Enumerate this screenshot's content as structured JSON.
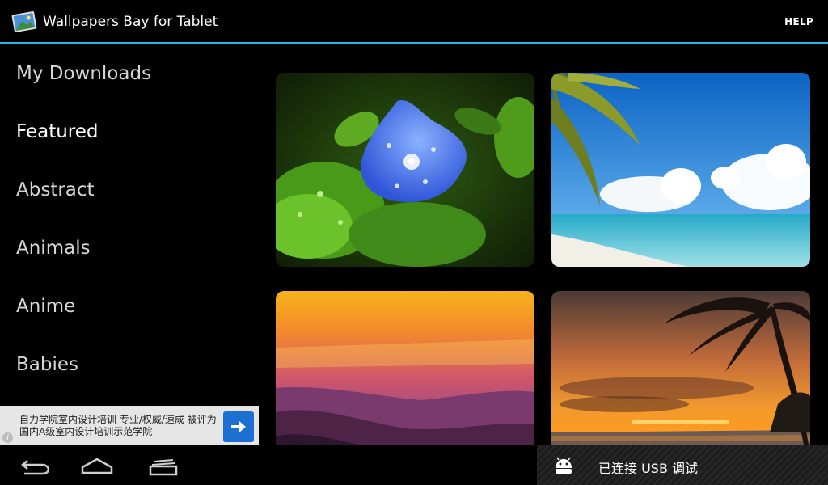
{
  "app": {
    "title": "Wallpapers Bay for Tablet",
    "help_label": "HELP"
  },
  "sidebar": {
    "items": [
      {
        "label": "My Downloads"
      },
      {
        "label": "Featured",
        "active": true
      },
      {
        "label": "Abstract"
      },
      {
        "label": "Animals"
      },
      {
        "label": "Anime"
      },
      {
        "label": "Babies"
      }
    ]
  },
  "wallpapers": [
    {
      "subject": "blue-flower-with-water-drops"
    },
    {
      "subject": "tropical-beach-with-palm"
    },
    {
      "subject": "purple-mountain-sunset"
    },
    {
      "subject": "palm-tree-sunset"
    }
  ],
  "ad": {
    "text": "自力学院室内设计培训 专业/权威/速成 被评为国内A级室内设计培训示范学院",
    "info_icon": "info-icon",
    "action_icon": "arrow-right-icon"
  },
  "navbar": {
    "buttons": [
      "back-icon",
      "home-icon",
      "recent-apps-icon"
    ]
  },
  "notification": {
    "icon": "android-icon",
    "text": "已连接 USB 调试"
  },
  "colors": {
    "accent": "#33b5e5",
    "ad_button": "#1e6fd2"
  }
}
